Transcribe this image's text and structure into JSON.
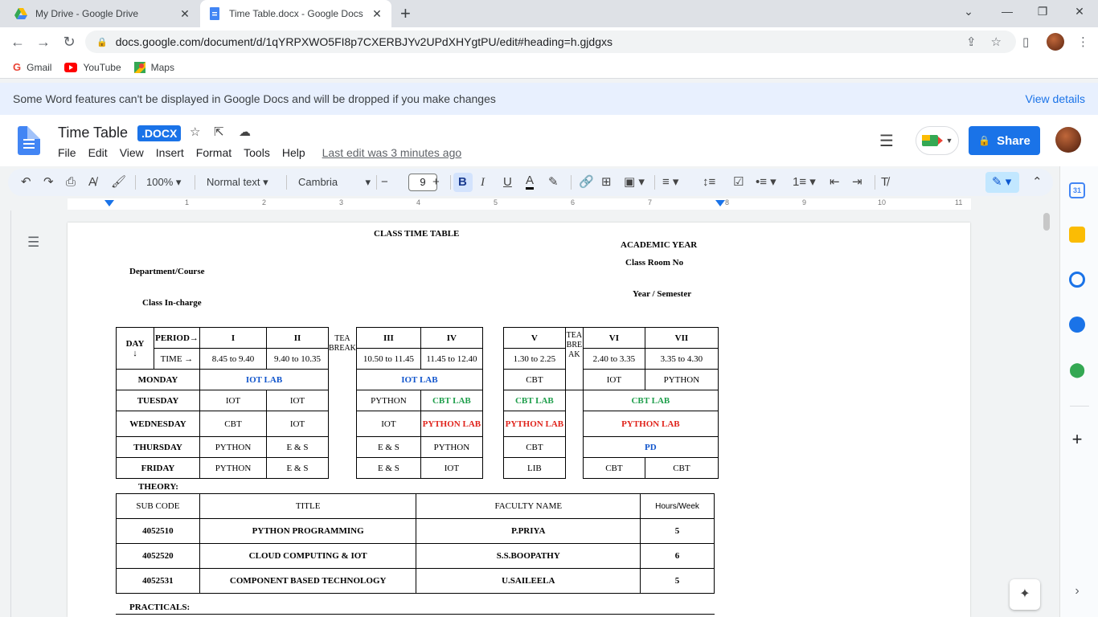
{
  "browser": {
    "tabs": [
      {
        "title": "My Drive - Google Drive",
        "active": false
      },
      {
        "title": "Time Table.docx - Google Docs",
        "active": true
      }
    ],
    "url": "docs.google.com/document/d/1qYRPXWO5FI8p7CXERBJYv2UPdXHYgtPU/edit#heading=h.gjdgxs",
    "bookmarks": [
      "Gmail",
      "YouTube",
      "Maps"
    ]
  },
  "banner": {
    "message": "Some Word features can't be displayed in Google Docs and will be dropped if you make changes",
    "link": "View details"
  },
  "docs": {
    "title": "Time Table",
    "badge": ".DOCX",
    "menu": [
      "File",
      "Edit",
      "View",
      "Insert",
      "Format",
      "Tools",
      "Help"
    ],
    "last_edit": "Last edit was 3 minutes ago",
    "share_label": "Share"
  },
  "format_bar": {
    "zoom": "100%",
    "style": "Normal text",
    "font": "Cambria",
    "font_size": "9"
  },
  "ruler_numbers": [
    "1",
    "2",
    "3",
    "4",
    "5",
    "6",
    "7",
    "8",
    "9",
    "10",
    "11"
  ],
  "document": {
    "heading": "CLASS TIME TABLE",
    "academic_year": "ACADEMIC YEAR",
    "class_room": "Class Room No",
    "department": "Department/Course",
    "year_semester": "Year / Semester",
    "class_incharge": "Class In-charge",
    "timetable": {
      "day_label": "DAY",
      "day_arrow": "↓",
      "period_label": "PERIOD→",
      "time_label": "TIME →",
      "tea_break_1": "TEA BREAK",
      "tea_break_2": "TEA BREAK",
      "periods": [
        "I",
        "II",
        "III",
        "IV",
        "V",
        "VI",
        "VII"
      ],
      "times": [
        "8.45 to 9.40",
        "9.40 to 10.35",
        "10.50 to 11.45",
        "11.45 to 12.40",
        "1.30 to 2.25",
        "2.40 to 3.35",
        "3.35 to 4.30"
      ],
      "rows": [
        {
          "day": "MONDAY",
          "p12": "IOT LAB",
          "p34": "IOT LAB",
          "p5": "CBT",
          "p6": "IOT",
          "p7": "PYTHON"
        },
        {
          "day": "TUESDAY",
          "p1": "IOT",
          "p2": "IOT",
          "p3": "PYTHON",
          "p4": "CBT LAB",
          "p5": "CBT LAB",
          "p67": "CBT LAB"
        },
        {
          "day": "WEDNESDAY",
          "p1": "CBT",
          "p2": "IOT",
          "p3": "IOT",
          "p4": "PYTHON LAB",
          "p5": "PYTHON LAB",
          "p67": "PYTHON LAB"
        },
        {
          "day": "THURSDAY",
          "p1": "PYTHON",
          "p2": "E & S",
          "p3": "E & S",
          "p4": "PYTHON",
          "p5": "CBT",
          "p67": "PD"
        },
        {
          "day": "FRIDAY",
          "p1": "PYTHON",
          "p2": "E & S",
          "p3": "E & S",
          "p4": "IOT",
          "p5": "LIB",
          "p6": "CBT",
          "p7": "CBT"
        }
      ]
    },
    "theory_label": "THEORY:",
    "theory": {
      "headers": [
        "SUB CODE",
        "TITLE",
        "FACULTY NAME",
        "Hours/Week"
      ],
      "rows": [
        [
          "4052510",
          "PYTHON PROGRAMMING",
          "P.PRIYA",
          "5"
        ],
        [
          "4052520",
          "CLOUD COMPUTING & IOT",
          "S.S.BOOPATHY",
          "6"
        ],
        [
          "4052531",
          "COMPONENT BASED TECHNOLOGY",
          "U.SAILEELA",
          "5"
        ]
      ]
    },
    "practicals_label": "PRACTICALS:"
  },
  "colors": {
    "lab_blue": "#1155cc",
    "lab_green": "#1e9e4b",
    "lab_red": "#e0231b",
    "share_button": "#1a73e8"
  }
}
